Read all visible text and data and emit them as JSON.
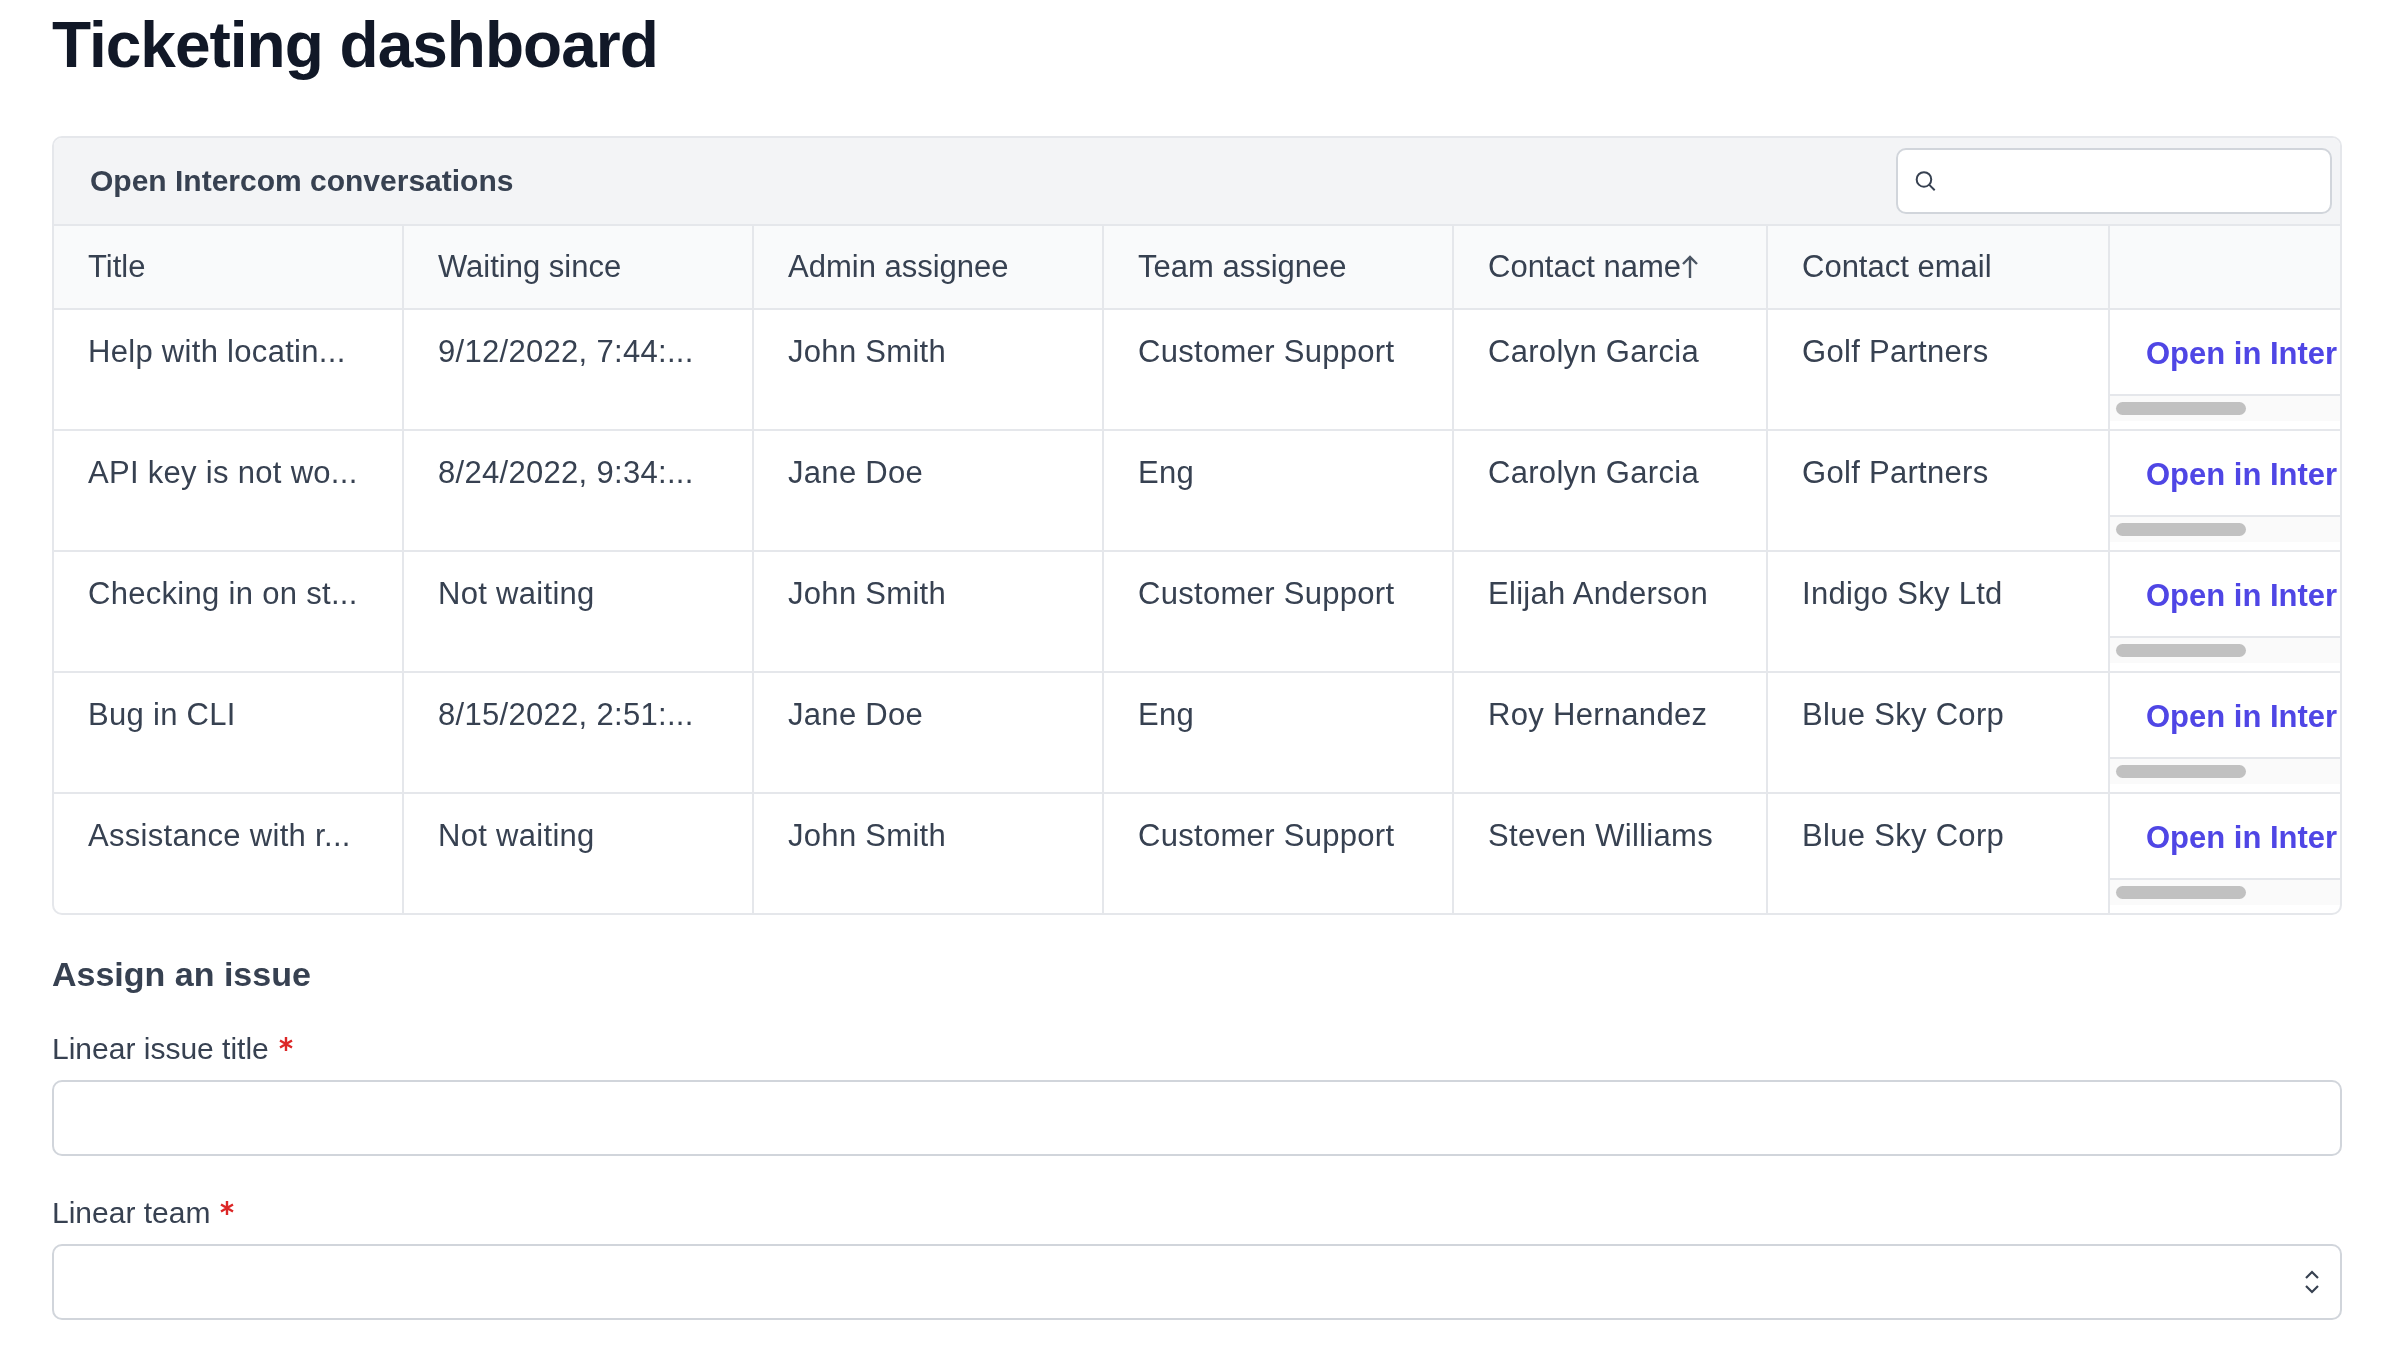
{
  "page": {
    "title": "Ticketing dashboard"
  },
  "conversations": {
    "title": "Open Intercom conversations",
    "columns": [
      {
        "label": "Title",
        "sorted": false
      },
      {
        "label": "Waiting since",
        "sorted": false
      },
      {
        "label": "Admin assignee",
        "sorted": false
      },
      {
        "label": "Team assignee",
        "sorted": false
      },
      {
        "label": "Contact name",
        "sorted": true
      },
      {
        "label": "Contact email",
        "sorted": false
      }
    ],
    "rows": [
      {
        "cells": [
          "Help with locatin...",
          "9/12/2022, 7:44:...",
          "John Smith",
          "Customer Support",
          "Carolyn Garcia",
          "Golf Partners"
        ],
        "link": "Open in Inter"
      },
      {
        "cells": [
          "API key is not wo...",
          "8/24/2022, 9:34:...",
          "Jane Doe",
          "Eng",
          "Carolyn Garcia",
          "Golf Partners"
        ],
        "link": "Open in Inter"
      },
      {
        "cells": [
          "Checking in on st...",
          "Not waiting",
          "John Smith",
          "Customer Support",
          "Elijah Anderson",
          "Indigo Sky Ltd"
        ],
        "link": "Open in Inter"
      },
      {
        "cells": [
          "Bug in CLI",
          "8/15/2022, 2:51:...",
          "Jane Doe",
          "Eng",
          "Roy Hernandez",
          "Blue Sky Corp"
        ],
        "link": "Open in Inter"
      },
      {
        "cells": [
          "Assistance with r...",
          "Not waiting",
          "John Smith",
          "Customer Support",
          "Steven Williams",
          "Blue Sky Corp"
        ],
        "link": "Open in Inter"
      }
    ]
  },
  "assign": {
    "title": "Assign an issue",
    "fields": [
      {
        "label": "Linear issue title",
        "required": true,
        "kind": "text"
      },
      {
        "label": "Linear team",
        "required": true,
        "kind": "select"
      }
    ]
  }
}
